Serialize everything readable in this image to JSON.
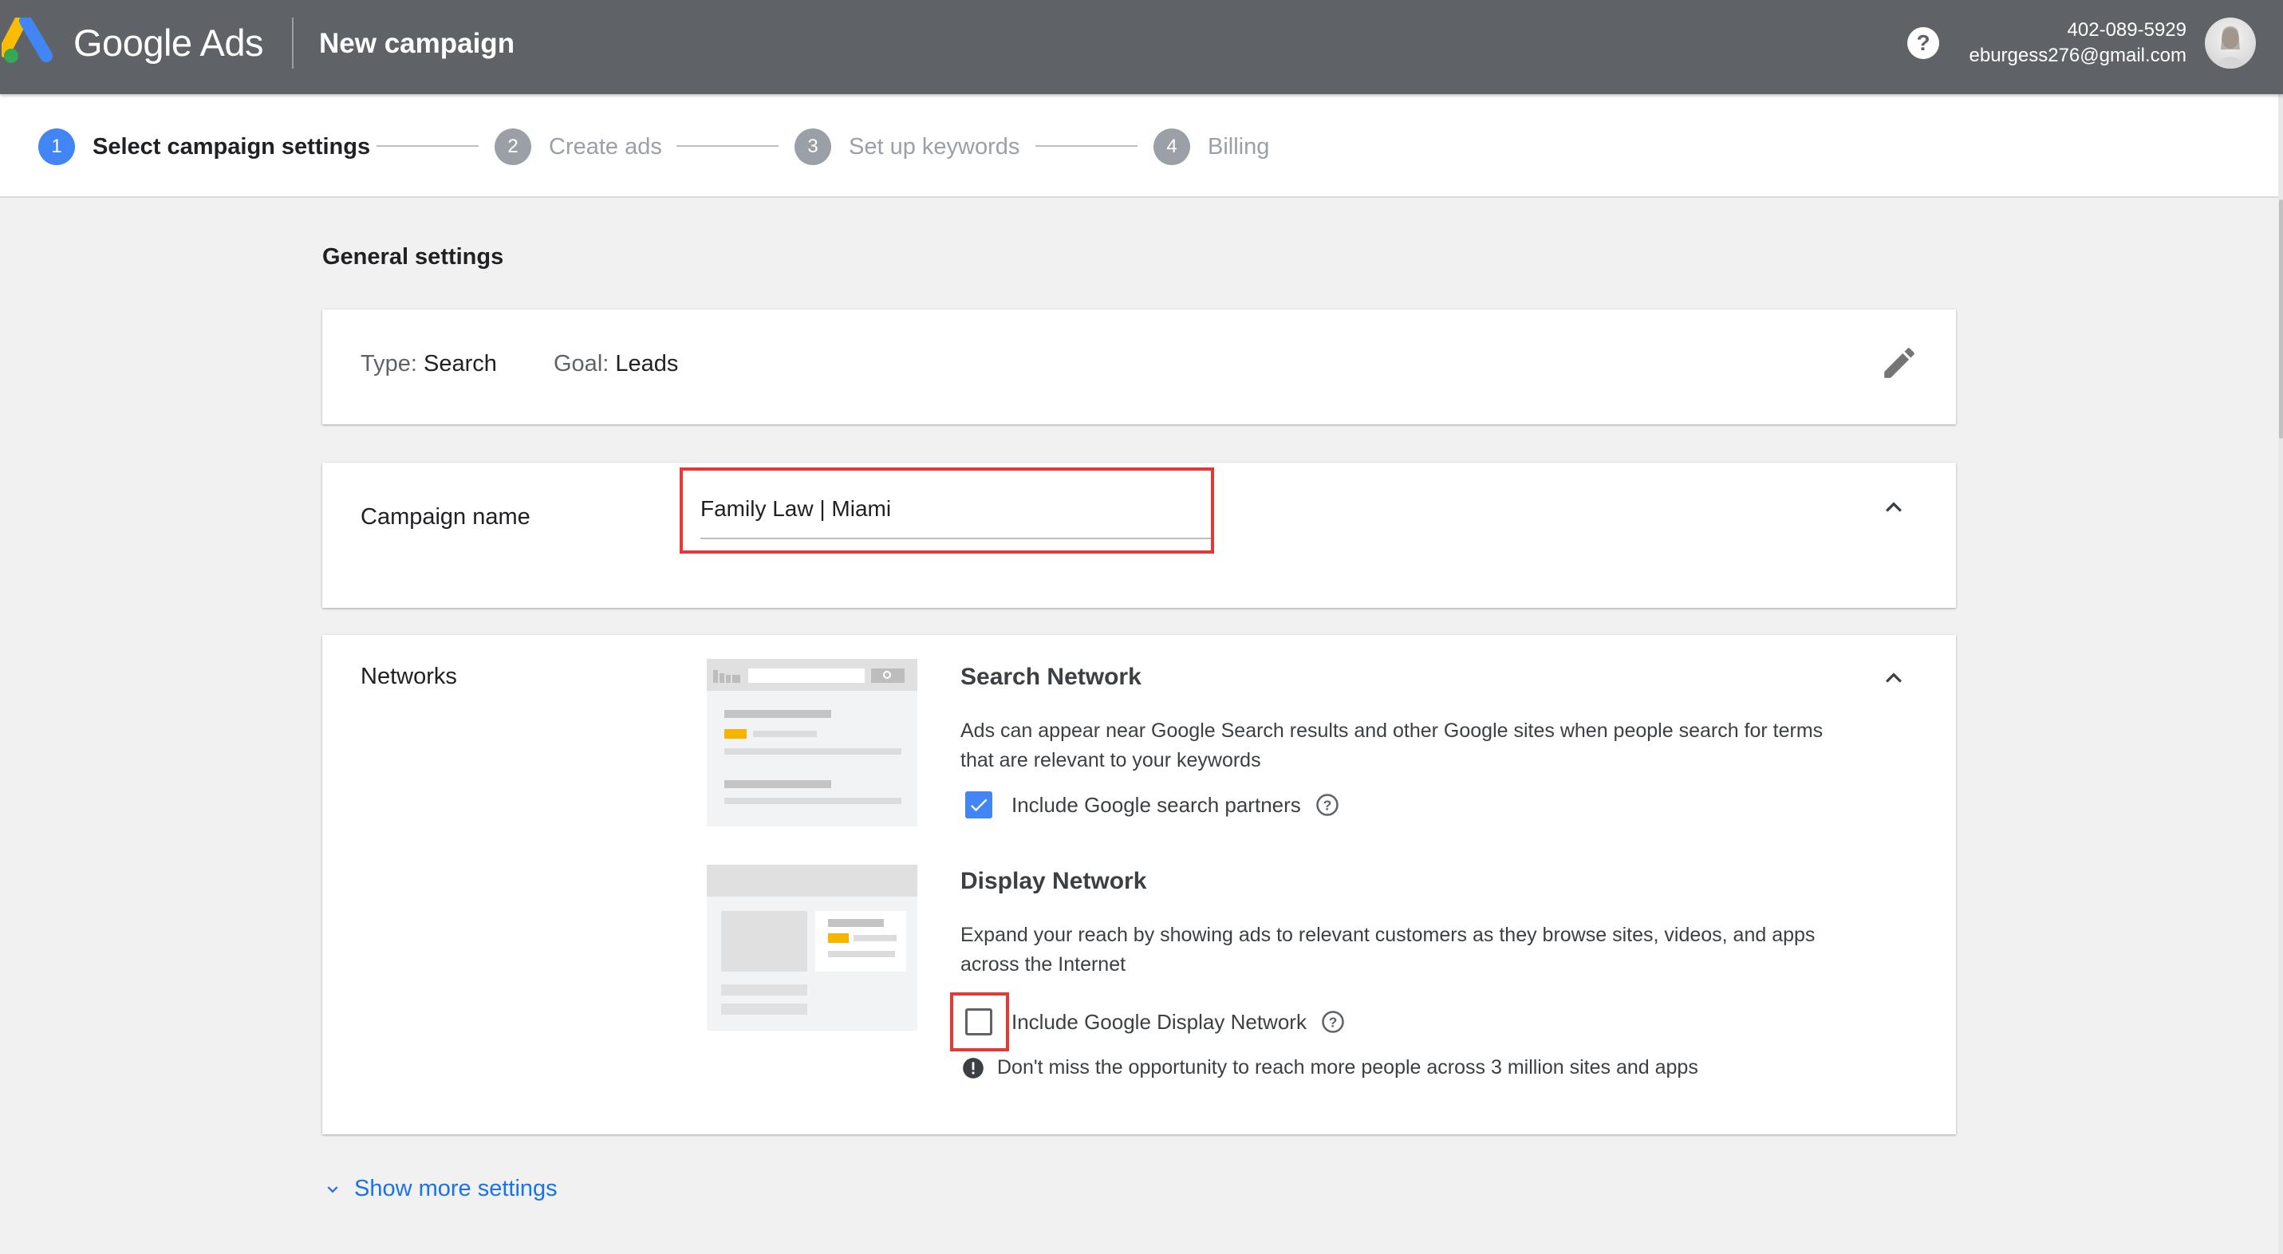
{
  "header": {
    "product_name": "Google Ads",
    "page_title": "New campaign",
    "account_phone": "402-089-5929",
    "account_email": "eburgess276@gmail.com"
  },
  "stepper": {
    "steps": [
      {
        "number": "1",
        "label": "Select campaign settings",
        "active": true
      },
      {
        "number": "2",
        "label": "Create ads",
        "active": false
      },
      {
        "number": "3",
        "label": "Set up keywords",
        "active": false
      },
      {
        "number": "4",
        "label": "Billing",
        "active": false
      }
    ]
  },
  "general_settings": {
    "title": "General settings",
    "type_label": "Type:",
    "type_value": "Search",
    "goal_label": "Goal:",
    "goal_value": "Leads"
  },
  "campaign_name": {
    "label": "Campaign name",
    "value": "Family Law | Miami"
  },
  "networks": {
    "label": "Networks",
    "search": {
      "title": "Search Network",
      "description": "Ads can appear near Google Search results and other Google sites when people search for terms that are relevant to your keywords",
      "checkbox_label": "Include Google search partners",
      "checked": true
    },
    "display": {
      "title": "Display Network",
      "description": "Expand your reach by showing ads to relevant customers as they browse sites, videos, and apps across the Internet",
      "checkbox_label": "Include Google Display Network",
      "checked": false,
      "warning": "Don't miss the opportunity to reach more people across 3 million sites and apps"
    }
  },
  "footer": {
    "show_more_label": "Show more settings"
  },
  "colors": {
    "header_bg": "#5f6368",
    "active_step": "#4285f4",
    "link": "#1a73e8",
    "highlight": "#e53935",
    "illustration_accent": "#f4b400"
  },
  "icons": [
    "google-ads-logo",
    "help-icon",
    "avatar",
    "edit-icon",
    "chevron-up-icon",
    "help-outline-icon",
    "warning-icon",
    "chevron-down-icon"
  ]
}
